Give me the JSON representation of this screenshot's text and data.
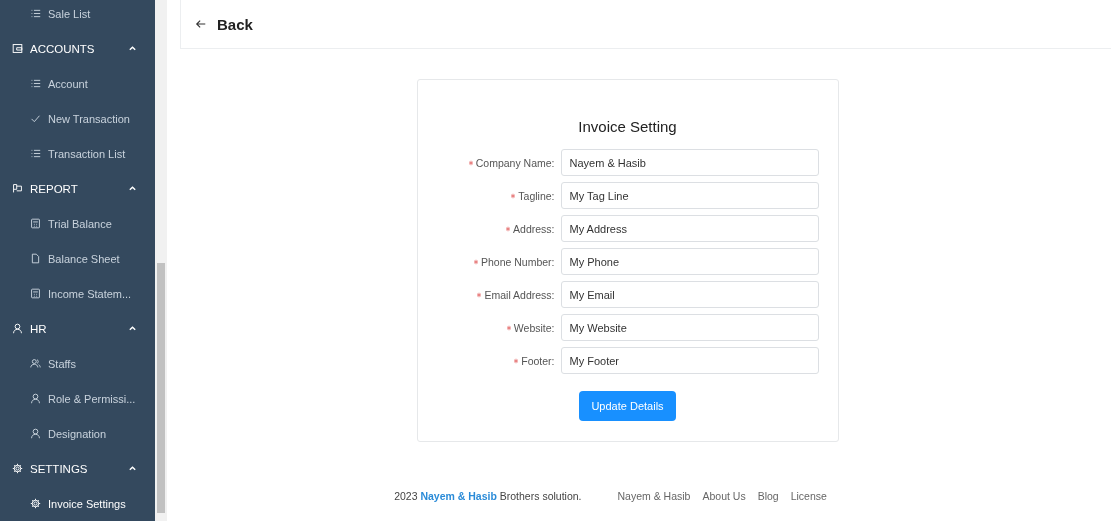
{
  "sidebar": {
    "items": [
      {
        "kind": "item",
        "label": "Sale List",
        "selected": false
      },
      {
        "kind": "group",
        "label": "ACCOUNTS",
        "expanded": true
      },
      {
        "kind": "item",
        "label": "Account",
        "selected": false
      },
      {
        "kind": "item",
        "label": "New Transaction",
        "selected": false
      },
      {
        "kind": "item",
        "label": "Transaction List",
        "selected": false
      },
      {
        "kind": "group",
        "label": "REPORT",
        "expanded": true
      },
      {
        "kind": "item",
        "label": "Trial Balance",
        "selected": false
      },
      {
        "kind": "item",
        "label": "Balance Sheet",
        "selected": false
      },
      {
        "kind": "item",
        "label": "Income Statem...",
        "selected": false
      },
      {
        "kind": "group",
        "label": "HR",
        "expanded": true
      },
      {
        "kind": "item",
        "label": "Staffs",
        "selected": false
      },
      {
        "kind": "item",
        "label": "Role & Permissi...",
        "selected": false
      },
      {
        "kind": "item",
        "label": "Designation",
        "selected": false
      },
      {
        "kind": "group",
        "label": "SETTINGS",
        "expanded": true
      },
      {
        "kind": "item",
        "label": "Invoice Settings",
        "selected": true
      }
    ]
  },
  "header": {
    "back_label": "Back"
  },
  "form": {
    "title": "Invoice Setting",
    "fields": [
      {
        "label": "Company Name:",
        "value": "Nayem & Hasib",
        "required": true
      },
      {
        "label": "Tagline:",
        "value": "My Tag Line",
        "required": true
      },
      {
        "label": "Address:",
        "value": "My Address",
        "required": true
      },
      {
        "label": "Phone Number:",
        "value": "My Phone",
        "required": true
      },
      {
        "label": "Email Address:",
        "value": "My Email",
        "required": true
      },
      {
        "label": "Website:",
        "value": "My Website",
        "required": true
      },
      {
        "label": "Footer:",
        "value": "My Footer",
        "required": true
      }
    ],
    "submit": "Update Details"
  },
  "footer": {
    "copyright": {
      "before": "2023",
      "link": "Nayem & Hasib",
      "after": "Brothers solution."
    },
    "links": [
      "Nayem & Hasib",
      "About Us",
      "Blog",
      "License"
    ]
  }
}
